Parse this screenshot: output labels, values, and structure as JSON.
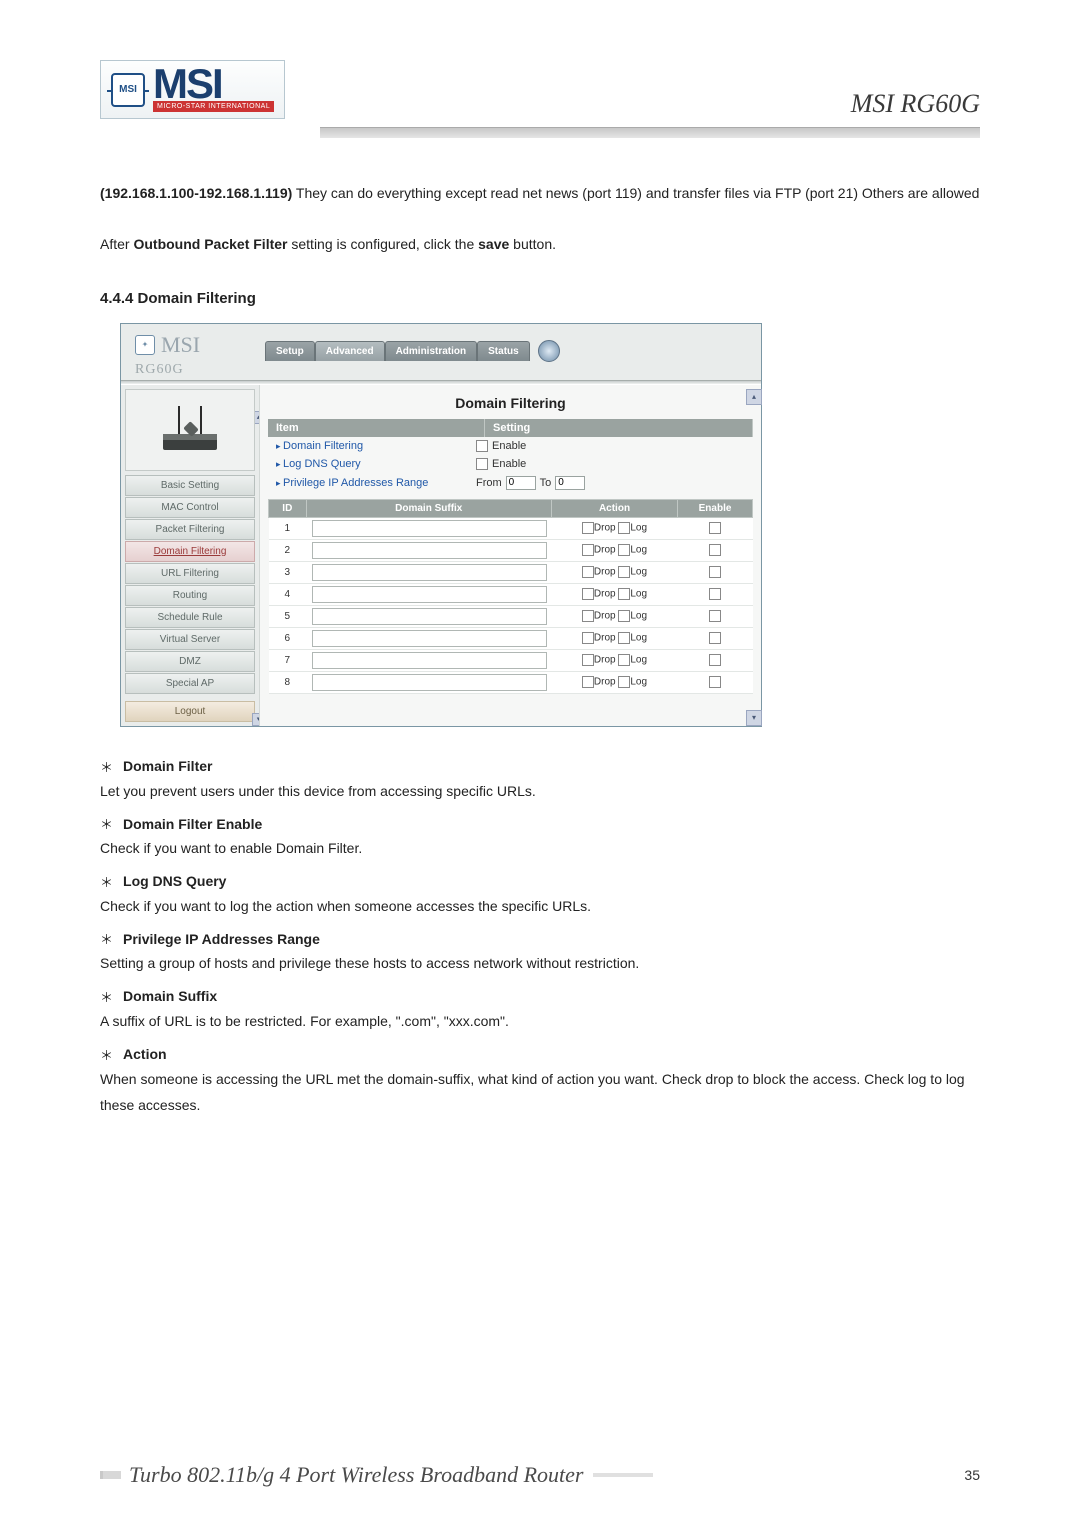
{
  "brand": {
    "name": "MSI",
    "sub": "MICRO-STAR INTERNATIONAL",
    "badge": "MSI"
  },
  "product_label": "MSI RG60G",
  "intro": {
    "ip_range_bold": "(192.168.1.100-192.168.1.119)",
    "ip_range_rest": " They can do everything except read net news (port 119) and transfer files via FTP (port 21) Others are allowed",
    "after_prefix": "After ",
    "after_bold1": "Outbound Packet Filter",
    "after_mid": " setting is configured, click the ",
    "after_bold2": "save",
    "after_suffix": " button."
  },
  "section_heading": "4.4.4 Domain Filtering",
  "router": {
    "brand": "MSI",
    "model": "RG60G",
    "tabs": [
      "Setup",
      "Advanced",
      "Administration",
      "Status"
    ],
    "active_tab_index": 1,
    "side_items": [
      "Basic Setting",
      "MAC Control",
      "Packet Filtering",
      "Domain Filtering",
      "URL Filtering",
      "Routing",
      "Schedule Rule",
      "Virtual Server",
      "DMZ",
      "Special AP"
    ],
    "side_selected_index": 3,
    "logout": "Logout",
    "panel_title": "Domain Filtering",
    "head_item": "Item",
    "head_setting": "Setting",
    "rows": [
      {
        "label": "Domain Filtering",
        "type": "enable",
        "text": "Enable"
      },
      {
        "label": "Log DNS Query",
        "type": "enable",
        "text": "Enable"
      },
      {
        "label": "Privilege IP Addresses Range",
        "type": "range",
        "from": "From",
        "to": "To",
        "from_val": "0",
        "to_val": "0"
      }
    ],
    "table_headers": [
      "ID",
      "Domain Suffix",
      "Action",
      "Enable"
    ],
    "action_drop": "Drop",
    "action_log": "Log",
    "rule_count": 8
  },
  "definitions": [
    {
      "term": "Domain Filter",
      "desc": "Let you prevent users under this device from accessing specific URLs."
    },
    {
      "term": "Domain Filter Enable",
      "desc": "Check if you want to enable Domain Filter."
    },
    {
      "term": "Log DNS Query",
      "desc": "Check if you want to log the action when someone accesses the specific URLs."
    },
    {
      "term": "Privilege IP Addresses Range",
      "desc": "Setting a group of hosts and privilege these hosts to access network without restriction."
    },
    {
      "term": "Domain Suffix",
      "desc": "A suffix of URL is to be restricted. For example, \".com\", \"xxx.com\"."
    },
    {
      "term": "Action",
      "desc": "When someone is accessing the URL met the domain-suffix, what kind of action you want. Check drop to block the access. Check log to log these accesses."
    }
  ],
  "footer": {
    "title": "Turbo 802.11b/g 4 Port Wireless Broadband Router",
    "page": "35"
  }
}
